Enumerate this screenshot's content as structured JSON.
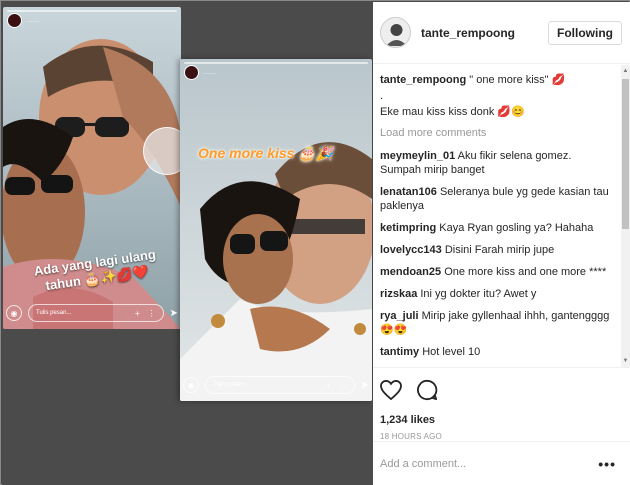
{
  "post": {
    "username": "tante_rempoong",
    "follow_label": "Following",
    "caption_user": "tante_rempoong",
    "caption_text": "\" one more kiss\" 💋",
    "caption_dot": ".",
    "caption_line2": "Eke mau kiss kiss donk 💋😊",
    "load_more": "Load more comments",
    "likes": "1,234 likes",
    "time": "18 HOURS AGO",
    "add_comment_placeholder": "Add a comment...",
    "more_label": "•••"
  },
  "comments": [
    {
      "user": "meymeylin_01",
      "text": "Aku fikir selena gomez. Sumpah mirip banget"
    },
    {
      "user": "lenatan106",
      "text": "Seleranya bule yg gede kasian tau paklenya"
    },
    {
      "user": "ketimpring",
      "text": "Kaya Ryan gosling ya? Hahaha"
    },
    {
      "user": "lovelycc143",
      "text": "Disini Farah mirip jupe"
    },
    {
      "user": "mendoan25",
      "text": "One more kiss and one more ****"
    },
    {
      "user": "rizskaa",
      "text": "Ini yg dokter itu? Awet y"
    },
    {
      "user": "rya_juli",
      "text": "Mirip jake gyllenhaal ihhh, gantengggg 😍😍"
    },
    {
      "user": "tantimy",
      "text": "Hot level 10"
    }
  ],
  "stories": {
    "story1_caption": "Ada yang lagi ulang tahun 🎂✨💋❤️",
    "story2_caption": "One more kiss 🎂🎉",
    "story_user": "........",
    "message_placeholder": "Tulis pesan...",
    "camera_icon": "camera-icon",
    "send_icon": "send-icon"
  },
  "colors": {
    "accent_orange": "#ff9a2b",
    "panel_bg": "#ffffff",
    "media_bg": "#4b4b4b"
  }
}
